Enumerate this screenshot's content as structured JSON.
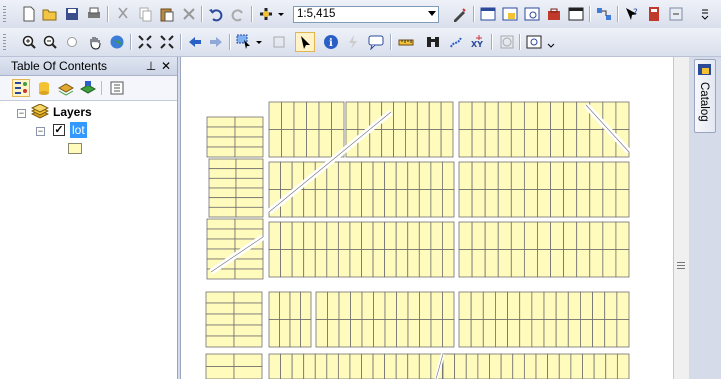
{
  "toolbar": {
    "scale_value": "1:5,415"
  },
  "toc": {
    "title": "Table Of Contents",
    "pin_glyph": "⊥",
    "close_glyph": "✕",
    "layers_label": "Layers",
    "layer_name": "lot",
    "layer_checked": true,
    "check_glyph": "✓",
    "collapse_glyph": "−"
  },
  "catalog": {
    "tab_label": "Catalog"
  },
  "colors": {
    "parcel_fill": "#fffbbc",
    "parcel_stroke": "#707070",
    "selection": "#3399ff"
  }
}
